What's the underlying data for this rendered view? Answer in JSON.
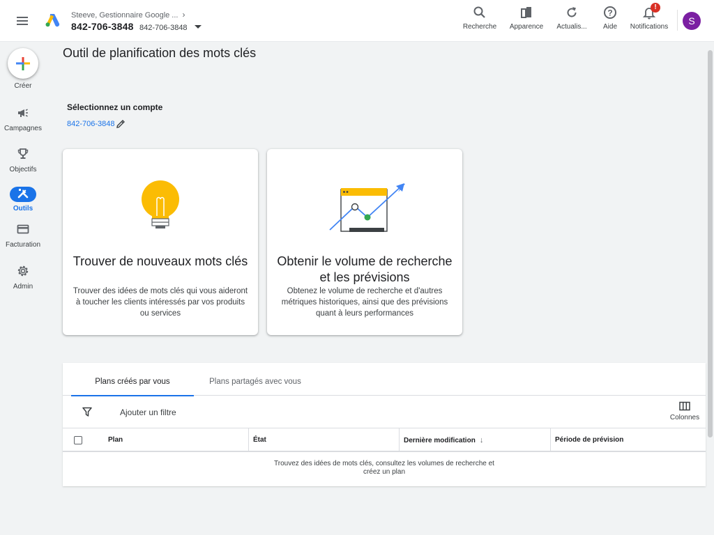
{
  "header": {
    "account_name": "Steeve, Gestionnaire Google ...",
    "account_id": "842-706-3848",
    "account_id_secondary": "842-706-3848",
    "tools": [
      {
        "label": "Recherche",
        "icon": "search-icon"
      },
      {
        "label": "Apparence",
        "icon": "appearance-icon"
      },
      {
        "label": "Actualis...",
        "icon": "refresh-icon"
      },
      {
        "label": "Aide",
        "icon": "help-icon"
      },
      {
        "label": "Notifications",
        "icon": "bell-icon"
      }
    ],
    "notification_badge": "!",
    "avatar_letter": "S"
  },
  "sidebar": {
    "create_label": "Créer",
    "items": [
      {
        "label": "Campagnes",
        "icon": "megaphone-icon",
        "active": false
      },
      {
        "label": "Objectifs",
        "icon": "trophy-icon",
        "active": false
      },
      {
        "label": "Outils",
        "icon": "tools-icon",
        "active": true
      },
      {
        "label": "Facturation",
        "icon": "credit-card-icon",
        "active": false
      },
      {
        "label": "Admin",
        "icon": "gear-icon",
        "active": false
      }
    ]
  },
  "main": {
    "page_title": "Outil de planification des mots clés",
    "select_account_title": "Sélectionnez un compte",
    "selected_account": "842-706-3848",
    "cards": [
      {
        "title": "Trouver de nouveaux mots clés",
        "description": "Trouver des idées de mots clés qui vous aideront à toucher les clients intéressés par vos produits ou services",
        "icon": "lightbulb-icon"
      },
      {
        "title": "Obtenir le volume de recherche et les prévisions",
        "description": "Obtenez le volume de recherche et d'autres métriques historiques, ainsi que des prévisions quant à leurs performances",
        "icon": "chart-forecast-icon"
      }
    ],
    "plans": {
      "tabs": [
        {
          "label": "Plans créés par vous",
          "active": true
        },
        {
          "label": "Plans partagés avec vous",
          "active": false
        }
      ],
      "add_filter_label": "Ajouter un filtre",
      "columns_label": "Colonnes",
      "table_headers": [
        "Plan",
        "État",
        "Dernière modification",
        "Période de prévision"
      ],
      "empty_message": "Trouvez des idées de mots clés, consultez les volumes de recherche et créez un plan"
    }
  },
  "colors": {
    "accent": "#1a73e8",
    "avatar": "#7b1fa2",
    "badge": "#d93025",
    "lightbulb": "#fbbc04"
  }
}
